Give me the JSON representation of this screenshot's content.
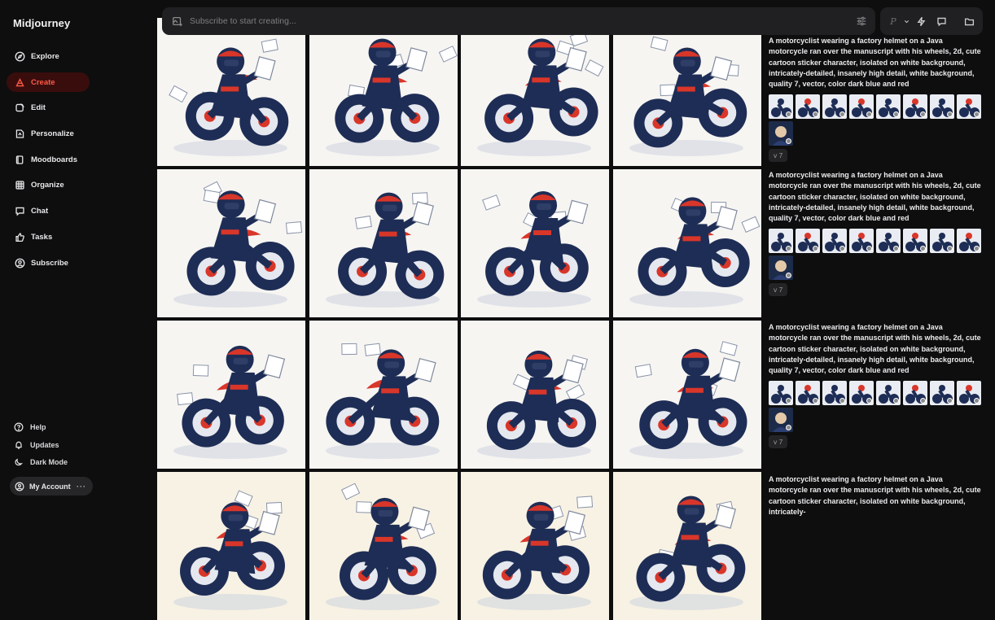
{
  "app": {
    "name": "Midjourney"
  },
  "nav": [
    {
      "label": "Explore",
      "icon": "compass-icon",
      "active": false
    },
    {
      "label": "Create",
      "icon": "brush-icon",
      "active": true
    },
    {
      "label": "Edit",
      "icon": "edit-icon",
      "active": false
    },
    {
      "label": "Personalize",
      "icon": "personalize-icon",
      "active": false
    },
    {
      "label": "Moodboards",
      "icon": "moodboard-icon",
      "active": false
    },
    {
      "label": "Organize",
      "icon": "grid-icon",
      "active": false
    },
    {
      "label": "Chat",
      "icon": "chat-icon",
      "active": false
    },
    {
      "label": "Tasks",
      "icon": "thumbs-up-icon",
      "active": false
    },
    {
      "label": "Subscribe",
      "icon": "subscribe-icon",
      "active": false
    }
  ],
  "bottom_nav": [
    {
      "label": "Help",
      "icon": "help-icon"
    },
    {
      "label": "Updates",
      "icon": "bell-icon"
    },
    {
      "label": "Dark Mode",
      "icon": "moon-icon"
    }
  ],
  "account": {
    "label": "My Account",
    "menu": "···"
  },
  "search": {
    "placeholder": "Subscribe to start creating..."
  },
  "toolbar": {
    "personalize_label": "P",
    "icons": [
      "chevron-down-icon",
      "lightning-icon",
      "chat-icon",
      "folder-icon"
    ]
  },
  "prompts": [
    {
      "text": "A motorcyclist wearing a factory helmet on a Java motorcycle ran over the manuscript with his wheels, 2d, cute cartoon sticker character, isolated on white background, intricately-detailed, insanely high detail, white background, quality 7, vector, color dark blue and red",
      "version": "v 7"
    },
    {
      "text": "A motorcyclist wearing a factory helmet on a Java motorcycle ran over the manuscript with his wheels, 2d, cute cartoon sticker character, isolated on white background, intricately-detailed, insanely high detail, white background, quality 7, vector, color dark blue and red",
      "version": "v 7"
    },
    {
      "text": "A motorcyclist wearing a factory helmet on a Java motorcycle ran over the manuscript with his wheels, 2d, cute cartoon sticker character, isolated on white background, intricately-detailed, insanely high detail, white background, quality 7, vector, color dark blue and red",
      "version": "v 7"
    },
    {
      "text": "A motorcyclist wearing a factory helmet on a Java motorcycle ran over the manuscript with his wheels, 2d, cute cartoon sticker character, isolated on white background, intricately-",
      "version": ""
    }
  ],
  "colors": {
    "navy": "#1e2d55",
    "red": "#d9362a",
    "accent": "#ff5a47",
    "background": "#0e0e0f",
    "panel": "#202022"
  }
}
